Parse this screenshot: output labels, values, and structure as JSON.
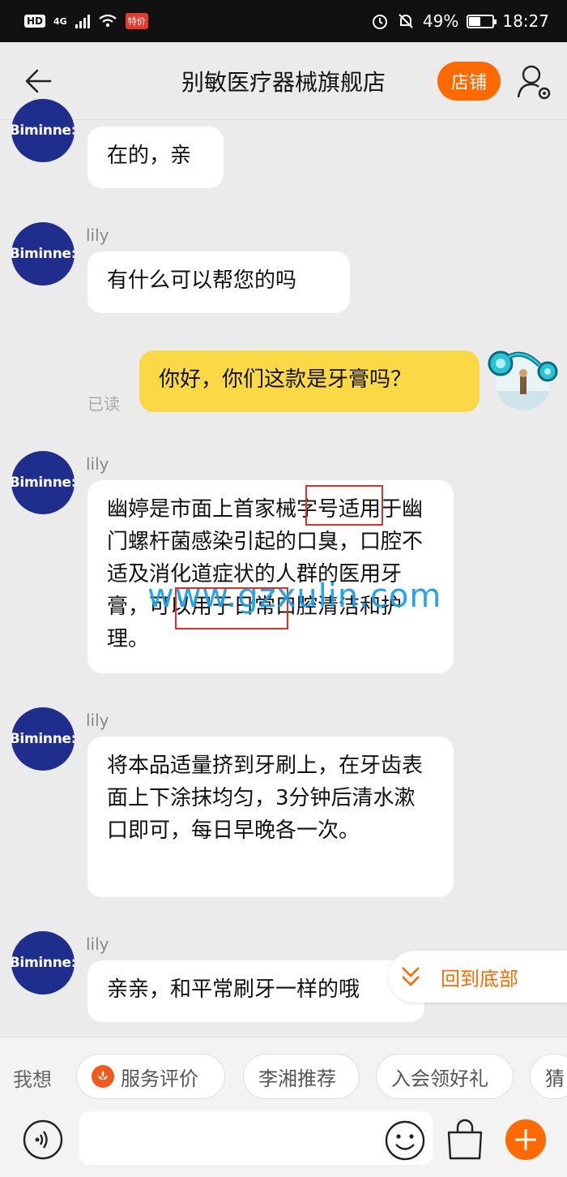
{
  "status_bar": {
    "hd": "HD",
    "network": "4G",
    "app_badge": "特价",
    "battery": "49%",
    "battery_fraction": 0.49,
    "time": "18:27"
  },
  "header": {
    "title": "别敏医疗器械旗舰店",
    "shop_label": "店铺"
  },
  "messages": [
    {
      "avatar_text": "Biminne:",
      "sender": "",
      "text": "在的，亲"
    },
    {
      "avatar_text": "Biminne:",
      "sender": "lily",
      "text": "有什么可以帮您的吗"
    },
    {
      "mine": true,
      "text": "你好，你们这款是牙膏吗？",
      "read_status": "已读"
    },
    {
      "avatar_text": "Biminne:",
      "sender": "lily",
      "text": "幽婷是市面上首家械字号适用于幽门螺杆菌感染引起的口臭，口腔不适及消化道症状的人群的医用牙膏，可以用于日常口腔清洁和护理。"
    },
    {
      "avatar_text": "Biminne:",
      "sender": "lily",
      "text": "将本品适量挤到牙刷上，在牙齿表面上下涂抹均匀，3分钟后清水漱口即可，每日早晚各一次。"
    },
    {
      "avatar_text": "Biminne:",
      "sender": "lily",
      "text": "亲亲，和平常刷牙一样的哦"
    }
  ],
  "watermark": "www.gzxulin.com",
  "scroll_to_bottom": "回到底部",
  "quick_replies": {
    "label": "我想",
    "chips": [
      "服务评价",
      "李湘推荐",
      "入会领好礼",
      "猜"
    ]
  },
  "input": {
    "placeholder": ""
  },
  "colors": {
    "accent": "#ff6a00",
    "my_bubble": "#fbd845",
    "avatar_bg": "#1f2d8c",
    "highlight_box": "#e0302a",
    "watermark": "#1aa0e8"
  }
}
